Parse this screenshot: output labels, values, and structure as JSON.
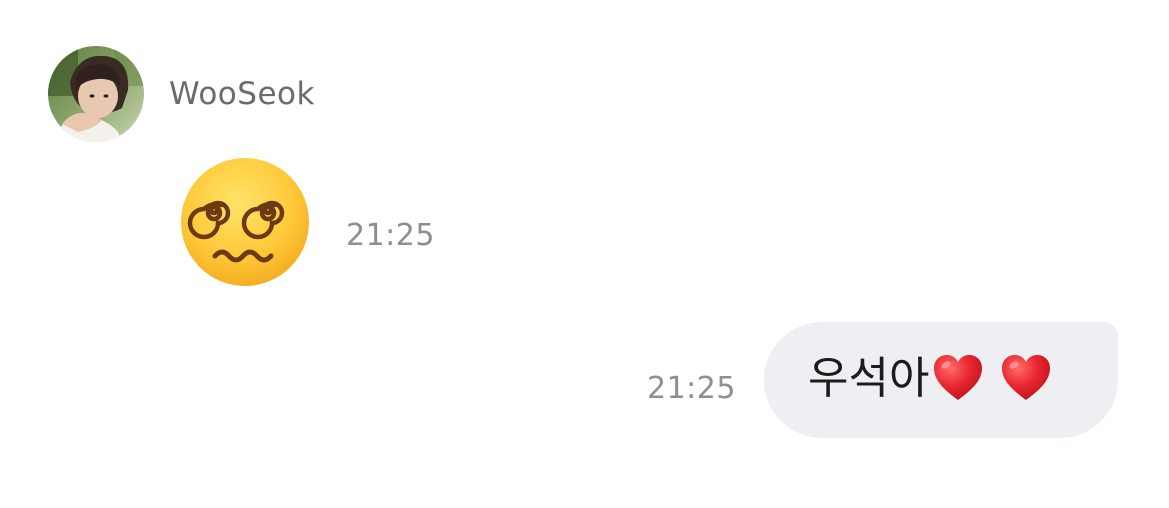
{
  "conversation": {
    "contact": {
      "name": "WooSeok",
      "avatar_icon": "profile-photo"
    },
    "messages": [
      {
        "direction": "incoming",
        "type": "emoji",
        "emoji_name": "face-with-spiral-eyes",
        "time": "21:25"
      },
      {
        "direction": "outgoing",
        "type": "text",
        "text": "우석아",
        "trailing_emojis": [
          "red-heart",
          "red-heart"
        ],
        "time": "21:25"
      }
    ]
  },
  "colors": {
    "outgoing_bubble": "#eeeff2",
    "timestamp": "#8e8e8e",
    "name": "#6b6b6b",
    "heart": "#e0232e"
  }
}
